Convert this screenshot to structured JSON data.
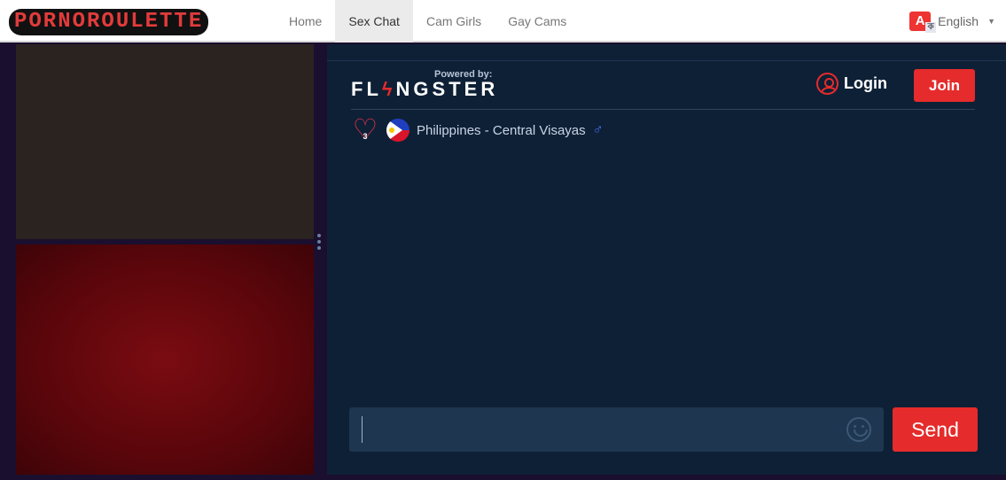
{
  "header": {
    "logo": "PORNOROULETTE",
    "nav": [
      {
        "label": "Home",
        "active": false
      },
      {
        "label": "Sex Chat",
        "active": true
      },
      {
        "label": "Cam Girls",
        "active": false
      },
      {
        "label": "Gay Cams",
        "active": false
      }
    ],
    "language": {
      "label": "English",
      "icon": "translate-icon"
    }
  },
  "video": {
    "remote_label": "Video feed",
    "local_label": ""
  },
  "chat": {
    "powered_by": "Powered by:",
    "brand": {
      "pre": "FL",
      "bolt": "ϟ",
      "post": "NGSTER"
    },
    "login_label": "Login",
    "join_label": "Join",
    "partner": {
      "likes": "3",
      "country": "Philippines - Central Visayas",
      "gender_symbol": "♂"
    },
    "input": {
      "value": "",
      "placeholder": ""
    },
    "send_label": "Send"
  },
  "colors": {
    "accent": "#e52b2b",
    "panel_bg": "#0e2036",
    "input_bg": "#1e3650"
  }
}
